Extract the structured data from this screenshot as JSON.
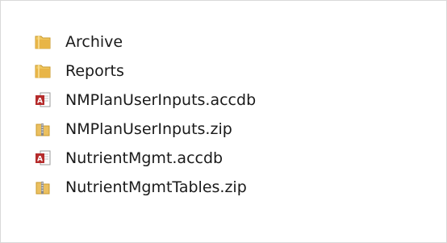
{
  "file_list": {
    "items": [
      {
        "name": "Archive",
        "type": "folder",
        "icon": "folder-icon"
      },
      {
        "name": "Reports",
        "type": "folder",
        "icon": "folder-icon"
      },
      {
        "name": "NMPlanUserInputs.accdb",
        "type": "access-database",
        "icon": "access-database-icon"
      },
      {
        "name": "NMPlanUserInputs.zip",
        "type": "zip-archive",
        "icon": "zip-archive-icon"
      },
      {
        "name": "NutrientMgmt.accdb",
        "type": "access-database",
        "icon": "access-database-icon"
      },
      {
        "name": "NutrientMgmtTables.zip",
        "type": "zip-archive",
        "icon": "zip-archive-icon"
      }
    ]
  },
  "colors": {
    "folder": "#e8b547",
    "access": "#b52b2b",
    "zip": "#d9a93a",
    "text": "#1a1a1a",
    "border": "#d9d9d9"
  }
}
